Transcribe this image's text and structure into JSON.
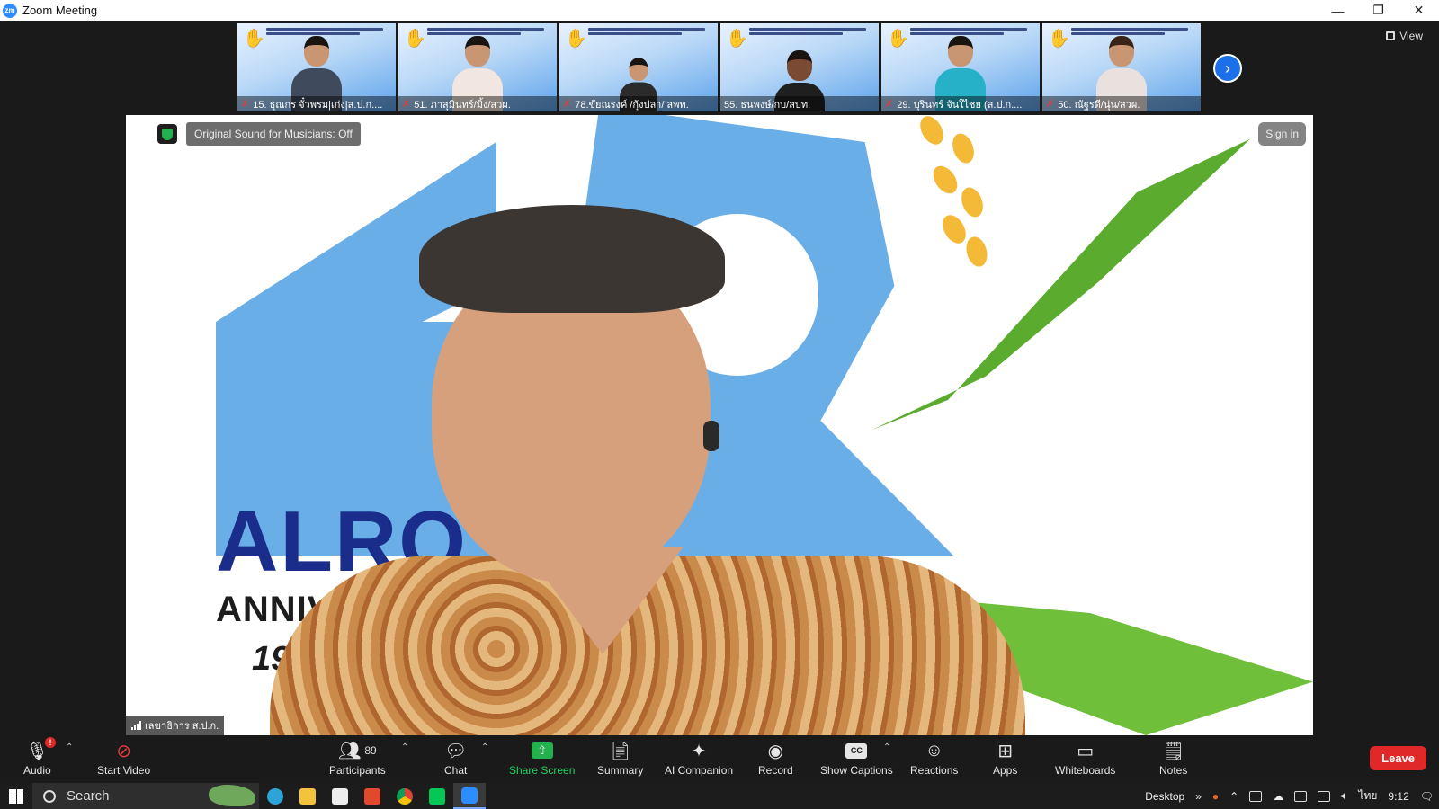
{
  "window": {
    "app_icon": "zm",
    "title": "Zoom Meeting",
    "controls": {
      "minimize": "—",
      "restore": "❐",
      "close": "✕"
    }
  },
  "gallery": {
    "participants": [
      {
        "name": "15. ธุณกร จั๋วพรม|เก่ง|ส.ป.ก...."
      },
      {
        "name": "51. ภาสุมินทร์/มิ้ง/สวผ."
      },
      {
        "name": "78.ขัยณรงค์ /กุ้งปลา/ สพพ."
      },
      {
        "name": "55. ธนพงษ์/กบ/สบท."
      },
      {
        "name": "29. บุรินทร์ จันใไชย (ส.ป.ก...."
      },
      {
        "name": "50. ณัฐรดี/นุ่น/สวผ."
      }
    ],
    "view_label": "View"
  },
  "main_video": {
    "original_sound_label": "Original Sound for Musicians: Off",
    "sign_in_label": "Sign in",
    "speaker_name": "เลขาธิการ ส.ป.ก.",
    "background_text": {
      "alro": "ALRO",
      "anniversary": "ANNIVERSAR",
      "year": "1975"
    }
  },
  "toolbar": {
    "audio": "Audio",
    "start_video": "Start Video",
    "participants": "Participants",
    "participants_count": "89",
    "chat": "Chat",
    "share_screen": "Share Screen",
    "summary": "Summary",
    "ai_companion": "AI Companion",
    "record": "Record",
    "show_captions": "Show Captions",
    "cc_icon_text": "CC",
    "reactions": "Reactions",
    "apps": "Apps",
    "whiteboards": "Whiteboards",
    "notes": "Notes",
    "leave": "Leave",
    "audio_badge": "!"
  },
  "taskbar": {
    "search_placeholder": "Search",
    "desktop_label": "Desktop",
    "chevron": "»",
    "language": "ไทย",
    "time": "9:12"
  }
}
